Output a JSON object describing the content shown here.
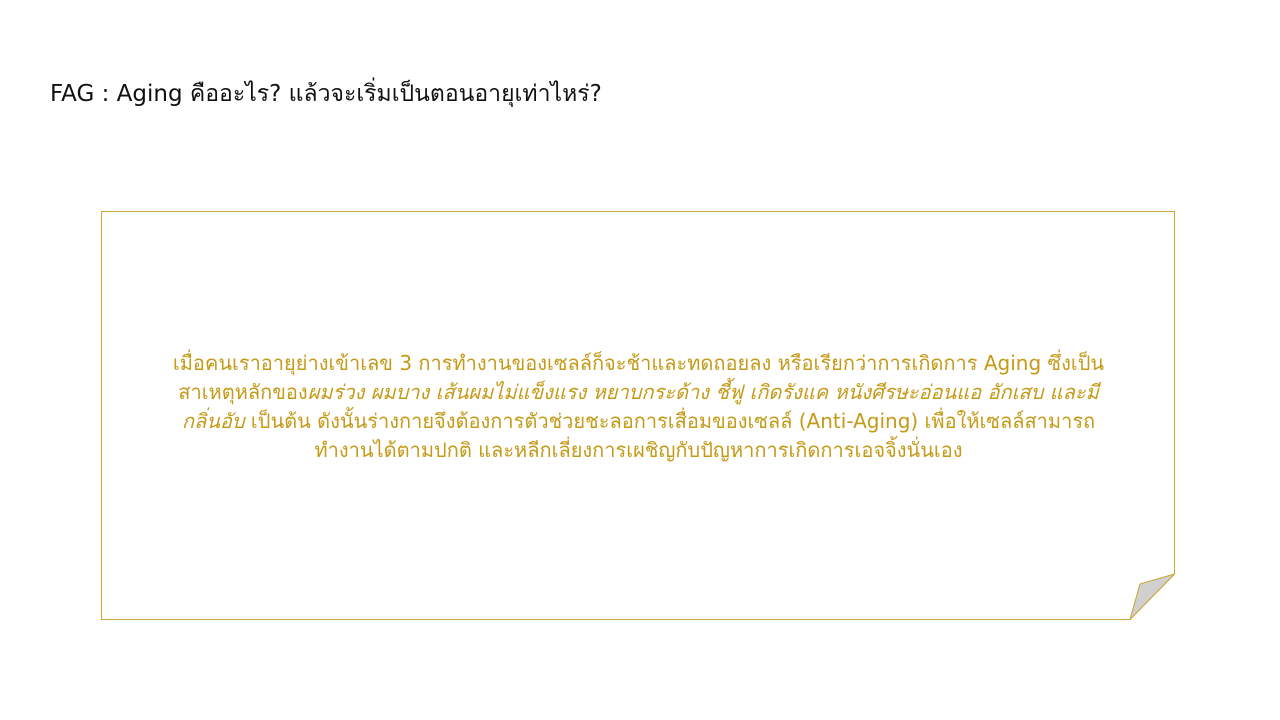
{
  "slide": {
    "title": "FAG : Aging คืออะไร? แล้วจะเริ่มเป็นตอนอายุเท่าไหร่?"
  },
  "note": {
    "line1": "เมื่อคนเราอายุย่างเข้าเลข 3 การทำงานของเซลล์ก็จะช้าและทดถอยลง หรือเรียกว่าการเกิดการ Aging ซึ่งเป็น",
    "line2_plain": "สาเหตุหลักของ",
    "line2_italic": "ผมร่วง ผมบาง เส้นผมไม่แข็งแรง หยาบกระด้าง ชี้ฟู เกิดรังแค หนังศีรษะอ่อนแอ อักเสบ และมี",
    "line3_italic": "กลิ่นอับ",
    "line3_plain": " เป็นต้น ดังนั้นร่างกายจึงต้องการตัวช่วยชะลอการเสื่อมของเซลล์ (Anti-Aging) เพื่อให้เซลล์สามารถ",
    "line4": "ทำงานได้ตามปกติ และหลีกเลี่ยงการเผชิญกับปัญหาการเกิดการเอจจิ้งนั่นเอง"
  },
  "colors": {
    "accent": "#c49a17",
    "border": "#c8a431",
    "fold": "#d0d0d0",
    "title": "#111111"
  }
}
